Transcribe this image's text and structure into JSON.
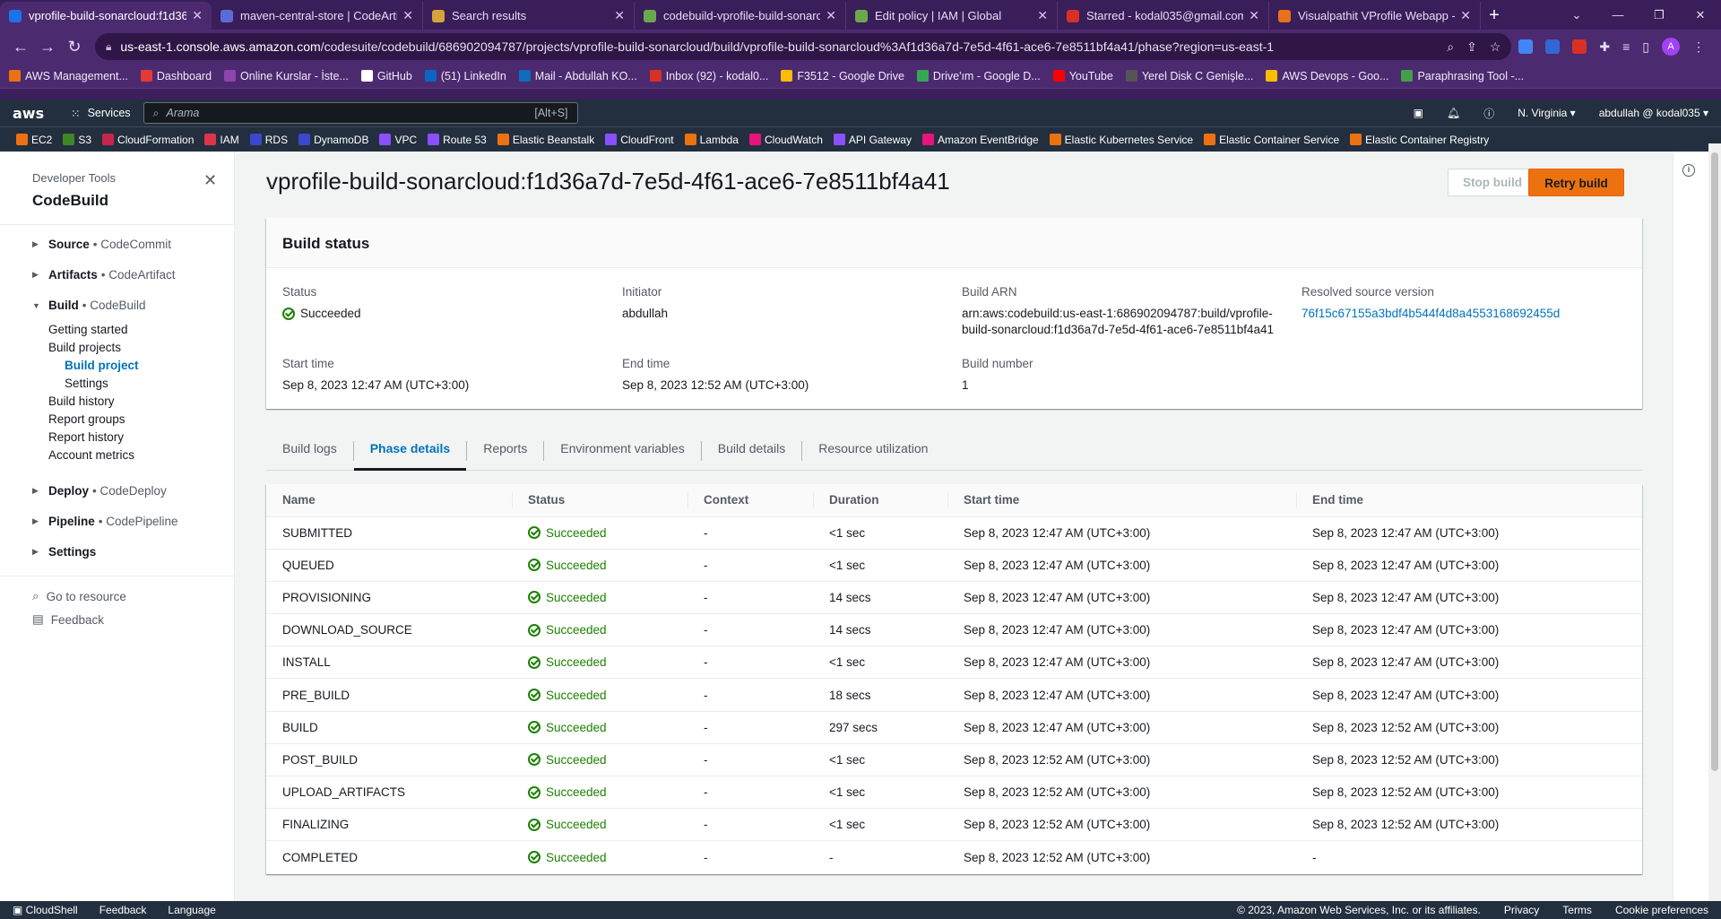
{
  "browser": {
    "tabs": [
      {
        "title": "vprofile-build-sonarcloud:f1d36",
        "color": "#1a73e8",
        "active": true
      },
      {
        "title": "maven-central-store | CodeArtif",
        "color": "#5b6cd8",
        "active": false
      },
      {
        "title": "Search results",
        "color": "#d6a33a",
        "active": false
      },
      {
        "title": "codebuild-vprofile-build-sonarc",
        "color": "#6aa84f",
        "active": false
      },
      {
        "title": "Edit policy | IAM | Global",
        "color": "#6aa84f",
        "active": false
      },
      {
        "title": "Starred - kodal035@gmail.com",
        "color": "#d93025",
        "active": false
      },
      {
        "title": "Visualpathit VProfile Webapp - I",
        "color": "#e8711a",
        "active": false
      }
    ],
    "url_host": "us-east-1.console.aws.amazon.com",
    "url_path": "/codesuite/codebuild/686902094787/projects/vprofile-build-sonarcloud/build/vprofile-build-sonarcloud%3Af1d36a7d-7e5d-4f61-ace6-7e8511bf4a41/phase?region=us-east-1",
    "bookmarks": [
      {
        "label": "AWS Management...",
        "color": "#ec7211"
      },
      {
        "label": "Dashboard",
        "color": "#e53935"
      },
      {
        "label": "Online Kurslar - İste...",
        "color": "#8e44ad"
      },
      {
        "label": "GitHub",
        "color": "#ffffff"
      },
      {
        "label": "(51) LinkedIn",
        "color": "#0a66c2"
      },
      {
        "label": "Mail - Abdullah KO...",
        "color": "#0f6cbd"
      },
      {
        "label": "Inbox (92) - kodal0...",
        "color": "#d93025"
      },
      {
        "label": "F3512 - Google Drive",
        "color": "#fbbc04"
      },
      {
        "label": "Drive'ım - Google D...",
        "color": "#34a853"
      },
      {
        "label": "YouTube",
        "color": "#ff0000"
      },
      {
        "label": "Yerel Disk C Genişle...",
        "color": "#555555"
      },
      {
        "label": "AWS Devops - Goo...",
        "color": "#fbbc04"
      },
      {
        "label": "Paraphrasing Tool -...",
        "color": "#43a047"
      }
    ]
  },
  "aws": {
    "logo": "aws",
    "services": "Services",
    "search_placeholder": "Arama",
    "search_shortcut": "[Alt+S]",
    "region": "N. Virginia ▾",
    "account": "abdullah @ kodal035 ▾",
    "favorites": [
      {
        "label": "EC2",
        "color": "#ec7211"
      },
      {
        "label": "S3",
        "color": "#3f8624"
      },
      {
        "label": "CloudFormation",
        "color": "#c7254e"
      },
      {
        "label": "IAM",
        "color": "#dd344c"
      },
      {
        "label": "RDS",
        "color": "#3b48cc"
      },
      {
        "label": "DynamoDB",
        "color": "#3b48cc"
      },
      {
        "label": "VPC",
        "color": "#8c4fff"
      },
      {
        "label": "Route 53",
        "color": "#8c4fff"
      },
      {
        "label": "Elastic Beanstalk",
        "color": "#ec7211"
      },
      {
        "label": "CloudFront",
        "color": "#8c4fff"
      },
      {
        "label": "Lambda",
        "color": "#ec7211"
      },
      {
        "label": "CloudWatch",
        "color": "#e7157b"
      },
      {
        "label": "API Gateway",
        "color": "#8c4fff"
      },
      {
        "label": "Amazon EventBridge",
        "color": "#e7157b"
      },
      {
        "label": "Elastic Kubernetes Service",
        "color": "#ec7211"
      },
      {
        "label": "Elastic Container Service",
        "color": "#ec7211"
      },
      {
        "label": "Elastic Container Registry",
        "color": "#ec7211"
      }
    ]
  },
  "sidebar": {
    "header": "Developer Tools",
    "title": "CodeBuild",
    "sections": {
      "source": {
        "label": "Source",
        "sub": "• CodeCommit"
      },
      "artifacts": {
        "label": "Artifacts",
        "sub": "• CodeArtifact"
      },
      "build": {
        "label": "Build",
        "sub": "• CodeBuild"
      },
      "deploy": {
        "label": "Deploy",
        "sub": "• CodeDeploy"
      },
      "pipeline": {
        "label": "Pipeline",
        "sub": "• CodePipeline"
      },
      "settings": {
        "label": "Settings"
      }
    },
    "build_items": {
      "getting_started": "Getting started",
      "build_projects": "Build projects",
      "build_project": "Build project",
      "settings": "Settings",
      "build_history": "Build history",
      "report_groups": "Report groups",
      "report_history": "Report history",
      "account_metrics": "Account metrics"
    },
    "go_to_resource": "Go to resource",
    "feedback": "Feedback"
  },
  "page": {
    "title": "vprofile-build-sonarcloud:f1d36a7d-7e5d-4f61-ace6-7e8511bf4a41",
    "stop_build": "Stop build",
    "retry_build": "Retry build"
  },
  "build_status": {
    "header": "Build status",
    "status_label": "Status",
    "status_value": "Succeeded",
    "initiator_label": "Initiator",
    "initiator_value": "abdullah",
    "arn_label": "Build ARN",
    "arn_line1": "arn:aws:codebuild:us-east-1:686902094787:build/vprofile-",
    "arn_line2": "build-sonarcloud:f1d36a7d-7e5d-4f61-ace6-7e8511bf4a41",
    "source_label": "Resolved source version",
    "source_value": "76f15c67155a3bdf4b544f4d8a4553168692455d",
    "start_label": "Start time",
    "start_value": "Sep 8, 2023 12:47 AM (UTC+3:00)",
    "end_label": "End time",
    "end_value": "Sep 8, 2023 12:52 AM (UTC+3:00)",
    "number_label": "Build number",
    "number_value": "1"
  },
  "tabs": [
    "Build logs",
    "Phase details",
    "Reports",
    "Environment variables",
    "Build details",
    "Resource utilization"
  ],
  "phases": {
    "columns": [
      "Name",
      "Status",
      "Context",
      "Duration",
      "Start time",
      "End time"
    ],
    "rows": [
      [
        "SUBMITTED",
        "Succeeded",
        "-",
        "<1 sec",
        "Sep 8, 2023 12:47 AM (UTC+3:00)",
        "Sep 8, 2023 12:47 AM (UTC+3:00)"
      ],
      [
        "QUEUED",
        "Succeeded",
        "-",
        "<1 sec",
        "Sep 8, 2023 12:47 AM (UTC+3:00)",
        "Sep 8, 2023 12:47 AM (UTC+3:00)"
      ],
      [
        "PROVISIONING",
        "Succeeded",
        "-",
        "14 secs",
        "Sep 8, 2023 12:47 AM (UTC+3:00)",
        "Sep 8, 2023 12:47 AM (UTC+3:00)"
      ],
      [
        "DOWNLOAD_SOURCE",
        "Succeeded",
        "-",
        "14 secs",
        "Sep 8, 2023 12:47 AM (UTC+3:00)",
        "Sep 8, 2023 12:47 AM (UTC+3:00)"
      ],
      [
        "INSTALL",
        "Succeeded",
        "-",
        "<1 sec",
        "Sep 8, 2023 12:47 AM (UTC+3:00)",
        "Sep 8, 2023 12:47 AM (UTC+3:00)"
      ],
      [
        "PRE_BUILD",
        "Succeeded",
        "-",
        "18 secs",
        "Sep 8, 2023 12:47 AM (UTC+3:00)",
        "Sep 8, 2023 12:47 AM (UTC+3:00)"
      ],
      [
        "BUILD",
        "Succeeded",
        "-",
        "297 secs",
        "Sep 8, 2023 12:47 AM (UTC+3:00)",
        "Sep 8, 2023 12:52 AM (UTC+3:00)"
      ],
      [
        "POST_BUILD",
        "Succeeded",
        "-",
        "<1 sec",
        "Sep 8, 2023 12:52 AM (UTC+3:00)",
        "Sep 8, 2023 12:52 AM (UTC+3:00)"
      ],
      [
        "UPLOAD_ARTIFACTS",
        "Succeeded",
        "-",
        "<1 sec",
        "Sep 8, 2023 12:52 AM (UTC+3:00)",
        "Sep 8, 2023 12:52 AM (UTC+3:00)"
      ],
      [
        "FINALIZING",
        "Succeeded",
        "-",
        "<1 sec",
        "Sep 8, 2023 12:52 AM (UTC+3:00)",
        "Sep 8, 2023 12:52 AM (UTC+3:00)"
      ],
      [
        "COMPLETED",
        "Succeeded",
        "-",
        "-",
        "Sep 8, 2023 12:52 AM (UTC+3:00)",
        "-"
      ]
    ]
  },
  "footer": {
    "cloudshell": "CloudShell",
    "feedback": "Feedback",
    "language": "Language",
    "copyright": "© 2023, Amazon Web Services, Inc. or its affiliates.",
    "privacy": "Privacy",
    "terms": "Terms",
    "cookies": "Cookie preferences"
  }
}
